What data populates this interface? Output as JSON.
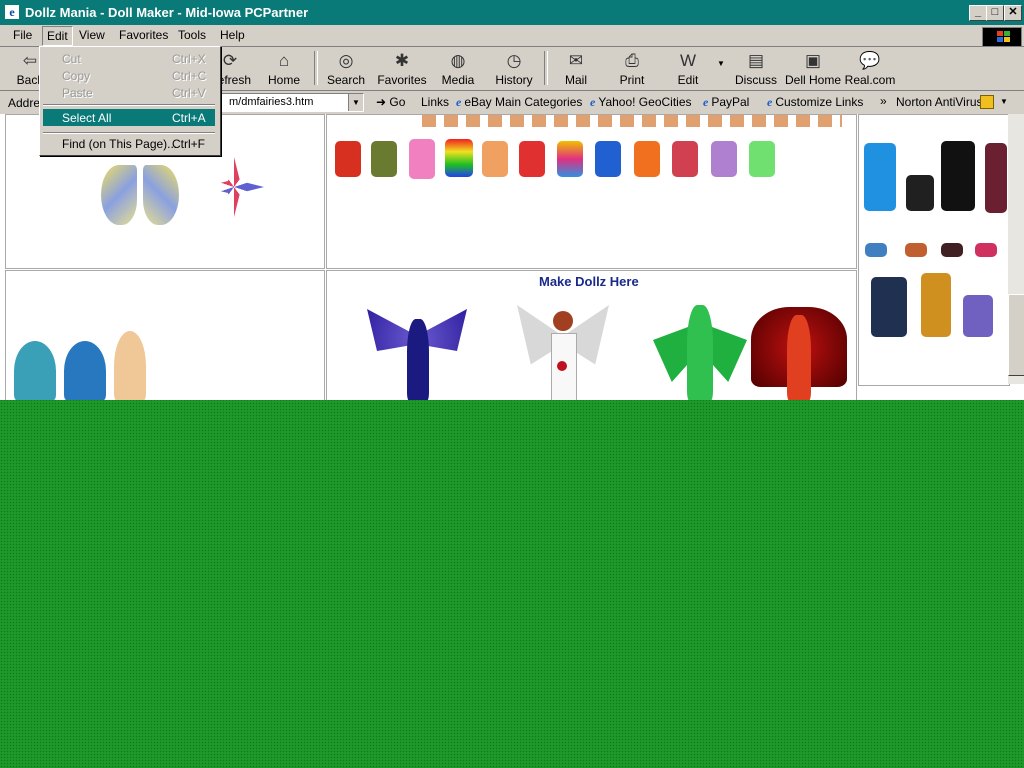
{
  "window": {
    "title": "Dollz Mania - Doll Maker - Mid-Iowa PCPartner",
    "title_icon": "ie-icon",
    "controls": [
      "_",
      "□",
      "✕"
    ]
  },
  "menubar": [
    "File",
    "Edit",
    "View",
    "Favorites",
    "Tools",
    "Help"
  ],
  "edit_menu": [
    {
      "label": "Cut",
      "shortcut": "Ctrl+X",
      "enabled": false
    },
    {
      "label": "Copy",
      "shortcut": "Ctrl+C",
      "enabled": false
    },
    {
      "label": "Paste",
      "shortcut": "Ctrl+V",
      "enabled": false
    },
    {
      "label": "Select All",
      "shortcut": "Ctrl+A",
      "enabled": true
    },
    {
      "label": "Find (on This Page)...",
      "shortcut": "Ctrl+F",
      "enabled": true
    }
  ],
  "toolbar": {
    "back": "Back",
    "refresh": "Refresh",
    "home": "Home",
    "search": "Search",
    "favorites": "Favorites",
    "media": "Media",
    "history": "History",
    "mail": "Mail",
    "print": "Print",
    "edit": "Edit",
    "discuss": "Discuss",
    "dell_home": "Dell Home",
    "real": "Real.com"
  },
  "addressbar": {
    "label": "Address",
    "url_visible": "m/dmfairies3.htm",
    "go": "Go",
    "links_label": "Links",
    "links": [
      "eBay Main Categories",
      "Yahoo! GeoCities",
      "PayPal",
      "Customize Links"
    ],
    "norton": "Norton AntiVirus"
  },
  "page": {
    "make_dollz": "Make Dollz Here"
  },
  "colors": {
    "titlebar": "#0a7a78",
    "desktop": "#1f9a2a",
    "make_dollz_text": "#1a2a8a"
  }
}
